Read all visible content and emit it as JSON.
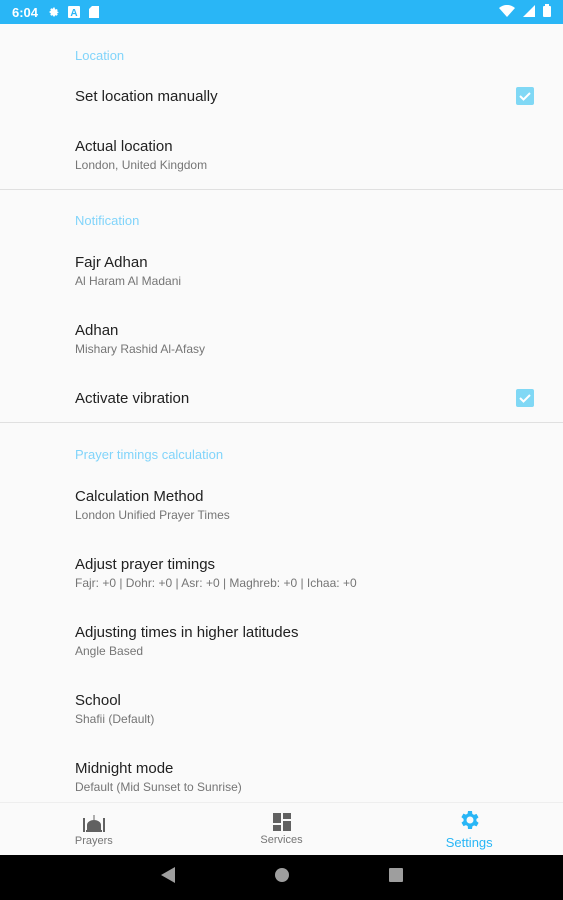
{
  "status_bar": {
    "time": "6:04"
  },
  "sections": {
    "location": {
      "header": "Location",
      "set_manually": {
        "title": "Set location manually",
        "checked": true
      },
      "actual_location": {
        "title": "Actual location",
        "summary": "London, United Kingdom"
      }
    },
    "notification": {
      "header": "Notification",
      "fajr_adhan": {
        "title": "Fajr Adhan",
        "summary": "Al Haram Al Madani"
      },
      "adhan": {
        "title": "Adhan",
        "summary": "Mishary Rashid Al-Afasy"
      },
      "vibration": {
        "title": "Activate vibration",
        "checked": true
      }
    },
    "calculation": {
      "header": "Prayer timings calculation",
      "method": {
        "title": "Calculation Method",
        "summary": "London Unified Prayer Times"
      },
      "adjust": {
        "title": "Adjust prayer timings",
        "summary": "Fajr: +0 | Dohr: +0 | Asr: +0 | Maghreb: +0 | Ichaa: +0"
      },
      "latitudes": {
        "title": "Adjusting times in higher latitudes",
        "summary": "Angle Based"
      },
      "school": {
        "title": "School",
        "summary": "Shafii (Default)"
      },
      "midnight": {
        "title": "Midnight mode",
        "summary": "Default (Mid Sunset to Sunrise)"
      }
    }
  },
  "bottom_nav": {
    "prayers": "Prayers",
    "services": "Services",
    "settings": "Settings",
    "active": "settings"
  },
  "colors": {
    "accent": "#29b6f6",
    "checkbox": "#80d8f5",
    "header_text": "#81d4fa"
  }
}
